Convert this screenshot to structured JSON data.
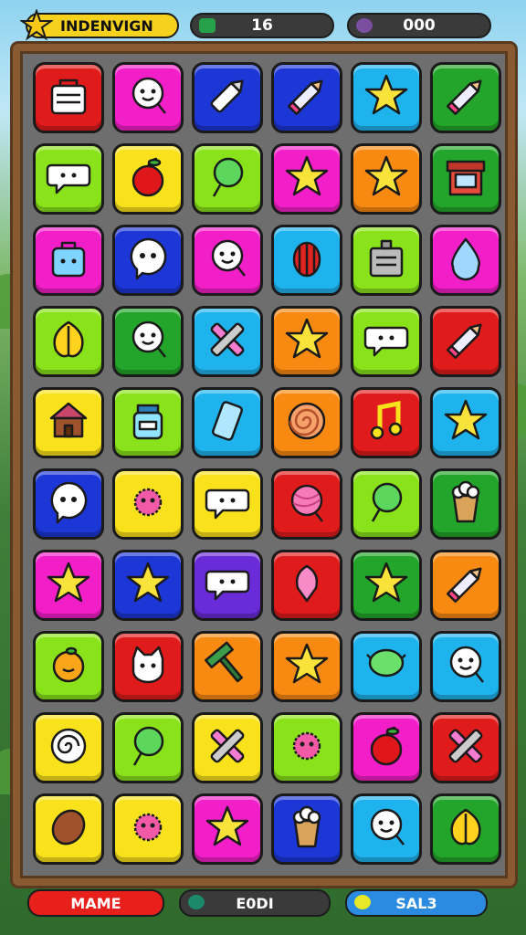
{
  "header": {
    "title_label": "INDENVIGN",
    "score_value": "16",
    "coins_value": "000"
  },
  "footer": {
    "left_label": "MAME",
    "center_label": "E0DI",
    "right_label": "SAL3"
  },
  "colors": {
    "red": "#e01b1b",
    "magenta": "#f21fc8",
    "blue": "#1d36d6",
    "cyan": "#1fb3ee",
    "green": "#22a52a",
    "lime": "#8ae21a",
    "yellow": "#f9e21c",
    "orange": "#f88a12",
    "purple": "#6a2bd8",
    "pink": "#f24ab0"
  },
  "board": {
    "rows": [
      [
        {
          "color": "red",
          "icon": "basket-icon"
        },
        {
          "color": "magenta",
          "icon": "face-lollipop-icon"
        },
        {
          "color": "blue",
          "icon": "crayon-icon"
        },
        {
          "color": "blue",
          "icon": "pencil-icon"
        },
        {
          "color": "cyan",
          "icon": "star-icon"
        },
        {
          "color": "green",
          "icon": "pencil-icon"
        }
      ],
      [
        {
          "color": "lime",
          "icon": "chat-bubble-icon"
        },
        {
          "color": "yellow",
          "icon": "apple-icon"
        },
        {
          "color": "lime",
          "icon": "lollipop-icon"
        },
        {
          "color": "magenta",
          "icon": "star-icon"
        },
        {
          "color": "orange",
          "icon": "star-icon"
        },
        {
          "color": "green",
          "icon": "shop-icon"
        }
      ],
      [
        {
          "color": "magenta",
          "icon": "bag-face-icon"
        },
        {
          "color": "blue",
          "icon": "ghost-bubble-icon"
        },
        {
          "color": "magenta",
          "icon": "face-lollipop-icon"
        },
        {
          "color": "cyan",
          "icon": "lantern-icon"
        },
        {
          "color": "lime",
          "icon": "box-icon"
        },
        {
          "color": "magenta",
          "icon": "drop-icon"
        }
      ],
      [
        {
          "color": "lime",
          "icon": "leaf-icon"
        },
        {
          "color": "green",
          "icon": "face-lollipop-icon"
        },
        {
          "color": "cyan",
          "icon": "crossed-crayons-icon"
        },
        {
          "color": "orange",
          "icon": "star-icon"
        },
        {
          "color": "lime",
          "icon": "chat-bubble-icon"
        },
        {
          "color": "red",
          "icon": "pencil-icon"
        }
      ],
      [
        {
          "color": "yellow",
          "icon": "house-icon"
        },
        {
          "color": "lime",
          "icon": "jar-icon"
        },
        {
          "color": "cyan",
          "icon": "phone-icon"
        },
        {
          "color": "orange",
          "icon": "swirl-candy-icon"
        },
        {
          "color": "red",
          "icon": "music-note-icon"
        },
        {
          "color": "cyan",
          "icon": "star-icon"
        }
      ],
      [
        {
          "color": "blue",
          "icon": "ghost-bubble-icon"
        },
        {
          "color": "yellow",
          "icon": "fuzzy-ball-icon"
        },
        {
          "color": "yellow",
          "icon": "chat-bubble-icon"
        },
        {
          "color": "red",
          "icon": "yarn-ball-icon"
        },
        {
          "color": "lime",
          "icon": "lollipop-icon"
        },
        {
          "color": "green",
          "icon": "popcorn-icon"
        }
      ],
      [
        {
          "color": "magenta",
          "icon": "star-icon"
        },
        {
          "color": "blue",
          "icon": "star-icon"
        },
        {
          "color": "purple",
          "icon": "chat-bubble-icon"
        },
        {
          "color": "red",
          "icon": "balloon-icon"
        },
        {
          "color": "green",
          "icon": "star-icon"
        },
        {
          "color": "orange",
          "icon": "pencil-icon"
        }
      ],
      [
        {
          "color": "lime",
          "icon": "orange-fruit-icon"
        },
        {
          "color": "red",
          "icon": "cat-face-icon"
        },
        {
          "color": "orange",
          "icon": "hammer-icon"
        },
        {
          "color": "orange",
          "icon": "star-icon"
        },
        {
          "color": "cyan",
          "icon": "leaf-bubble-icon"
        },
        {
          "color": "cyan",
          "icon": "face-lollipop-icon"
        }
      ],
      [
        {
          "color": "yellow",
          "icon": "spiral-bubble-icon"
        },
        {
          "color": "lime",
          "icon": "lollipop-icon"
        },
        {
          "color": "yellow",
          "icon": "crossed-crayons-icon"
        },
        {
          "color": "lime",
          "icon": "fuzzy-ball-icon"
        },
        {
          "color": "magenta",
          "icon": "apple-icon"
        },
        {
          "color": "red",
          "icon": "crossed-crayons-icon"
        }
      ],
      [
        {
          "color": "yellow",
          "icon": "seed-icon"
        },
        {
          "color": "yellow",
          "icon": "fuzzy-ball-icon"
        },
        {
          "color": "magenta",
          "icon": "star-icon"
        },
        {
          "color": "blue",
          "icon": "popcorn-icon"
        },
        {
          "color": "cyan",
          "icon": "face-lollipop-icon"
        },
        {
          "color": "green",
          "icon": "leaf-icon"
        }
      ]
    ]
  }
}
